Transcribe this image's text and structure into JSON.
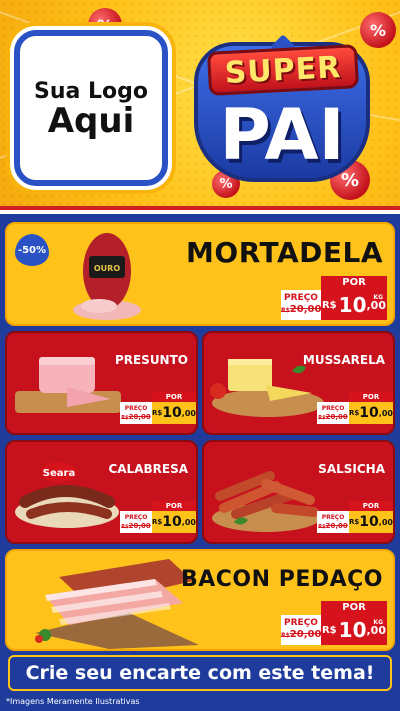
{
  "header": {
    "logo_line1": "Sua Logo",
    "logo_line2": "Aqui",
    "badge_top": "SUPER",
    "badge_bottom": "PAI",
    "balloon_symbol": "%"
  },
  "featured": [
    {
      "name": "MORTADELA",
      "discount": "-50%",
      "preco_label": "PREÇO",
      "old_prefix": "R$",
      "old_price": "20,00",
      "por_label": "POR",
      "currency": "R$",
      "price_int": "10",
      "price_dec": ",00",
      "unit": "KG",
      "brand": "OURO"
    },
    {
      "name": "BACON PEDAÇO",
      "preco_label": "PREÇO",
      "old_prefix": "R$",
      "old_price": "20,00",
      "por_label": "POR",
      "currency": "R$",
      "price_int": "10",
      "price_dec": ",00",
      "unit": "KG"
    }
  ],
  "products": [
    {
      "name": "PRESUNTO",
      "preco_label": "PREÇO",
      "old_prefix": "R$",
      "old_price": "20,00",
      "por_label": "POR",
      "currency": "R$",
      "price_int": "10",
      "price_dec": ",00"
    },
    {
      "name": "MUSSARELA",
      "preco_label": "PREÇO",
      "old_prefix": "R$",
      "old_price": "20,00",
      "por_label": "POR",
      "currency": "R$",
      "price_int": "10",
      "price_dec": ",00"
    },
    {
      "name": "CALABRESA",
      "preco_label": "PREÇO",
      "old_prefix": "R$",
      "old_price": "20,00",
      "por_label": "POR",
      "currency": "R$",
      "price_int": "10",
      "price_dec": ",00",
      "brand": "Seara"
    },
    {
      "name": "SALSICHA",
      "preco_label": "PREÇO",
      "old_prefix": "R$",
      "old_price": "20,00",
      "por_label": "POR",
      "currency": "R$",
      "price_int": "10",
      "price_dec": ",00"
    }
  ],
  "cta": "Crie seu encarte com este tema!",
  "note": "*Imagens Meramente Ilustrativas",
  "colors": {
    "yellow": "#ffc21a",
    "red": "#c7121e",
    "blue": "#1f3c9c"
  }
}
